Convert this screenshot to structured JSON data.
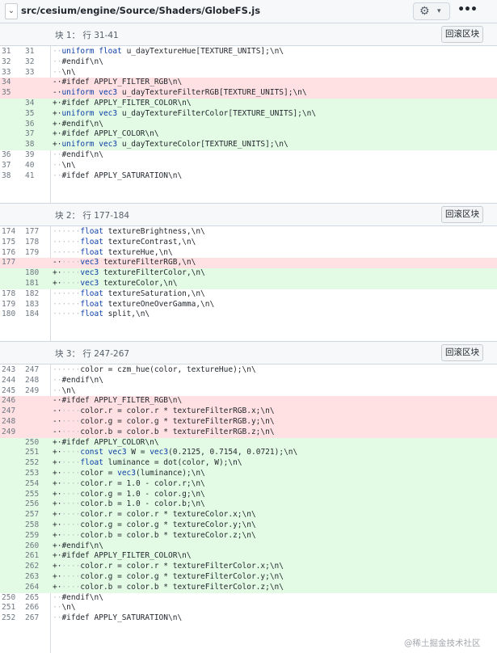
{
  "header": {
    "file_path": "src/cesium/engine/Source/Shaders/GlobeFS.js",
    "collapse_icon": "chevron-down-icon",
    "settings_icon": "gear-icon",
    "more_icon": "kebab-icon",
    "more_label": "•••"
  },
  "hunks": [
    {
      "label": "块 1： 行 31-41",
      "revert_label": "回滚区块",
      "lines": [
        {
          "t": "ctx",
          "o": "31",
          "n": "31",
          "s": " ",
          "code": "uniform float u_dayTextureHue[TEXTURE_UNITS];\\n\\"
        },
        {
          "t": "ctx",
          "o": "32",
          "n": "32",
          "s": " ",
          "code": "#endif\\n\\"
        },
        {
          "t": "ctx",
          "o": "33",
          "n": "33",
          "s": " ",
          "code": "\\n\\"
        },
        {
          "t": "del",
          "o": "34",
          "n": "",
          "s": "-",
          "code": "#ifdef APPLY_FILTER_RGB\\n\\"
        },
        {
          "t": "del",
          "o": "35",
          "n": "",
          "s": "-",
          "code": "uniform vec3 u_dayTextureFilterRGB[TEXTURE_UNITS];\\n\\"
        },
        {
          "t": "add",
          "o": "",
          "n": "34",
          "s": "+",
          "code": "#ifdef APPLY_FILTER_COLOR\\n\\"
        },
        {
          "t": "add",
          "o": "",
          "n": "35",
          "s": "+",
          "code": "uniform vec3 u_dayTextureFilterColor[TEXTURE_UNITS];\\n\\"
        },
        {
          "t": "add",
          "o": "",
          "n": "36",
          "s": "+",
          "code": "#endif\\n\\"
        },
        {
          "t": "add",
          "o": "",
          "n": "37",
          "s": "+",
          "code": "#ifdef APPLY_COLOR\\n\\"
        },
        {
          "t": "add",
          "o": "",
          "n": "38",
          "s": "+",
          "code": "uniform vec3 u_dayTextureColor[TEXTURE_UNITS];\\n\\"
        },
        {
          "t": "ctx",
          "o": "36",
          "n": "39",
          "s": " ",
          "code": "#endif\\n\\"
        },
        {
          "t": "ctx",
          "o": "37",
          "n": "40",
          "s": " ",
          "code": "\\n\\"
        },
        {
          "t": "ctx",
          "o": "38",
          "n": "41",
          "s": " ",
          "code": "#ifdef APPLY_SATURATION\\n\\"
        }
      ]
    },
    {
      "label": "块 2： 行 177-184",
      "revert_label": "回滚区块",
      "lines": [
        {
          "t": "ctx",
          "o": "174",
          "n": "177",
          "s": " ",
          "code": "    float textureBrightness,\\n\\"
        },
        {
          "t": "ctx",
          "o": "175",
          "n": "178",
          "s": " ",
          "code": "    float textureContrast,\\n\\"
        },
        {
          "t": "ctx",
          "o": "176",
          "n": "179",
          "s": " ",
          "code": "    float textureHue,\\n\\"
        },
        {
          "t": "del",
          "o": "177",
          "n": "",
          "s": "-",
          "code": "    vec3 textureFilterRGB,\\n\\"
        },
        {
          "t": "add",
          "o": "",
          "n": "180",
          "s": "+",
          "code": "    vec3 textureFilterColor,\\n\\"
        },
        {
          "t": "add",
          "o": "",
          "n": "181",
          "s": "+",
          "code": "    vec3 textureColor,\\n\\"
        },
        {
          "t": "ctx",
          "o": "178",
          "n": "182",
          "s": " ",
          "code": "    float textureSaturation,\\n\\"
        },
        {
          "t": "ctx",
          "o": "179",
          "n": "183",
          "s": " ",
          "code": "    float textureOneOverGamma,\\n\\"
        },
        {
          "t": "ctx",
          "o": "180",
          "n": "184",
          "s": " ",
          "code": "    float split,\\n\\"
        }
      ]
    },
    {
      "label": "块 3： 行 247-267",
      "revert_label": "回滚区块",
      "lines": [
        {
          "t": "ctx",
          "o": "243",
          "n": "247",
          "s": " ",
          "code": "    color = czm_hue(color, textureHue);\\n\\"
        },
        {
          "t": "ctx",
          "o": "244",
          "n": "248",
          "s": " ",
          "code": "#endif\\n\\"
        },
        {
          "t": "ctx",
          "o": "245",
          "n": "249",
          "s": " ",
          "code": "\\n\\"
        },
        {
          "t": "del",
          "o": "246",
          "n": "",
          "s": "-",
          "code": "#ifdef APPLY_FILTER_RGB\\n\\"
        },
        {
          "t": "del",
          "o": "247",
          "n": "",
          "s": "-",
          "code": "    color.r = color.r * textureFilterRGB.x;\\n\\"
        },
        {
          "t": "del",
          "o": "248",
          "n": "",
          "s": "-",
          "code": "    color.g = color.g * textureFilterRGB.y;\\n\\"
        },
        {
          "t": "del",
          "o": "249",
          "n": "",
          "s": "-",
          "code": "    color.b = color.b * textureFilterRGB.z;\\n\\"
        },
        {
          "t": "add",
          "o": "",
          "n": "250",
          "s": "+",
          "code": "#ifdef APPLY_COLOR\\n\\"
        },
        {
          "t": "add",
          "o": "",
          "n": "251",
          "s": "+",
          "code": "    const vec3 W = vec3(0.2125, 0.7154, 0.0721);\\n\\"
        },
        {
          "t": "add",
          "o": "",
          "n": "252",
          "s": "+",
          "code": "    float luminance = dot(color, W);\\n\\"
        },
        {
          "t": "add",
          "o": "",
          "n": "253",
          "s": "+",
          "code": "    color = vec3(luminance);\\n\\"
        },
        {
          "t": "add",
          "o": "",
          "n": "254",
          "s": "+",
          "code": "    color.r = 1.0 - color.r;\\n\\"
        },
        {
          "t": "add",
          "o": "",
          "n": "255",
          "s": "+",
          "code": "    color.g = 1.0 - color.g;\\n\\"
        },
        {
          "t": "add",
          "o": "",
          "n": "256",
          "s": "+",
          "code": "    color.b = 1.0 - color.b;\\n\\"
        },
        {
          "t": "add",
          "o": "",
          "n": "257",
          "s": "+",
          "code": "    color.r = color.r * textureColor.x;\\n\\"
        },
        {
          "t": "add",
          "o": "",
          "n": "258",
          "s": "+",
          "code": "    color.g = color.g * textureColor.y;\\n\\"
        },
        {
          "t": "add",
          "o": "",
          "n": "259",
          "s": "+",
          "code": "    color.b = color.b * textureColor.z;\\n\\"
        },
        {
          "t": "add",
          "o": "",
          "n": "260",
          "s": "+",
          "code": "#endif\\n\\"
        },
        {
          "t": "add",
          "o": "",
          "n": "261",
          "s": "+",
          "code": "#ifdef APPLY_FILTER_COLOR\\n\\"
        },
        {
          "t": "add",
          "o": "",
          "n": "262",
          "s": "+",
          "code": "    color.r = color.r * textureFilterColor.x;\\n\\"
        },
        {
          "t": "add",
          "o": "",
          "n": "263",
          "s": "+",
          "code": "    color.g = color.g * textureFilterColor.y;\\n\\"
        },
        {
          "t": "add",
          "o": "",
          "n": "264",
          "s": "+",
          "code": "    color.b = color.b * textureFilterColor.z;\\n\\"
        },
        {
          "t": "ctx",
          "o": "250",
          "n": "265",
          "s": " ",
          "code": "#endif\\n\\"
        },
        {
          "t": "ctx",
          "o": "251",
          "n": "266",
          "s": " ",
          "code": "\\n\\"
        },
        {
          "t": "ctx",
          "o": "252",
          "n": "267",
          "s": " ",
          "code": "#ifdef APPLY_SATURATION\\n\\"
        }
      ]
    }
  ],
  "watermark": "@稀土掘金技术社区",
  "colors": {
    "deleted_line_bg": "#ffe1e3",
    "added_line_bg": "#e3fbe4",
    "keyword": "#0a3ea8"
  }
}
